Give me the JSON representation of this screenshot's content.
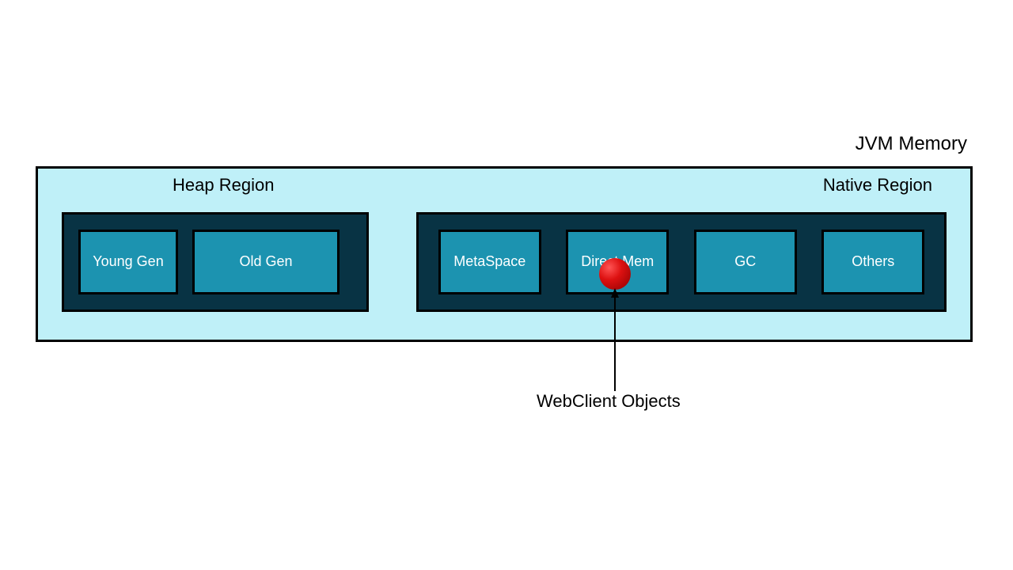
{
  "title": "JVM Memory",
  "heap": {
    "label": "Heap Region",
    "young": "Young Gen",
    "old": "Old Gen"
  },
  "native": {
    "label": "Native Region",
    "cells": {
      "metaspace": "MetaSpace",
      "direct": "Direct Mem",
      "gc": "GC",
      "others": "Others"
    }
  },
  "annotation": "WebClient Objects"
}
